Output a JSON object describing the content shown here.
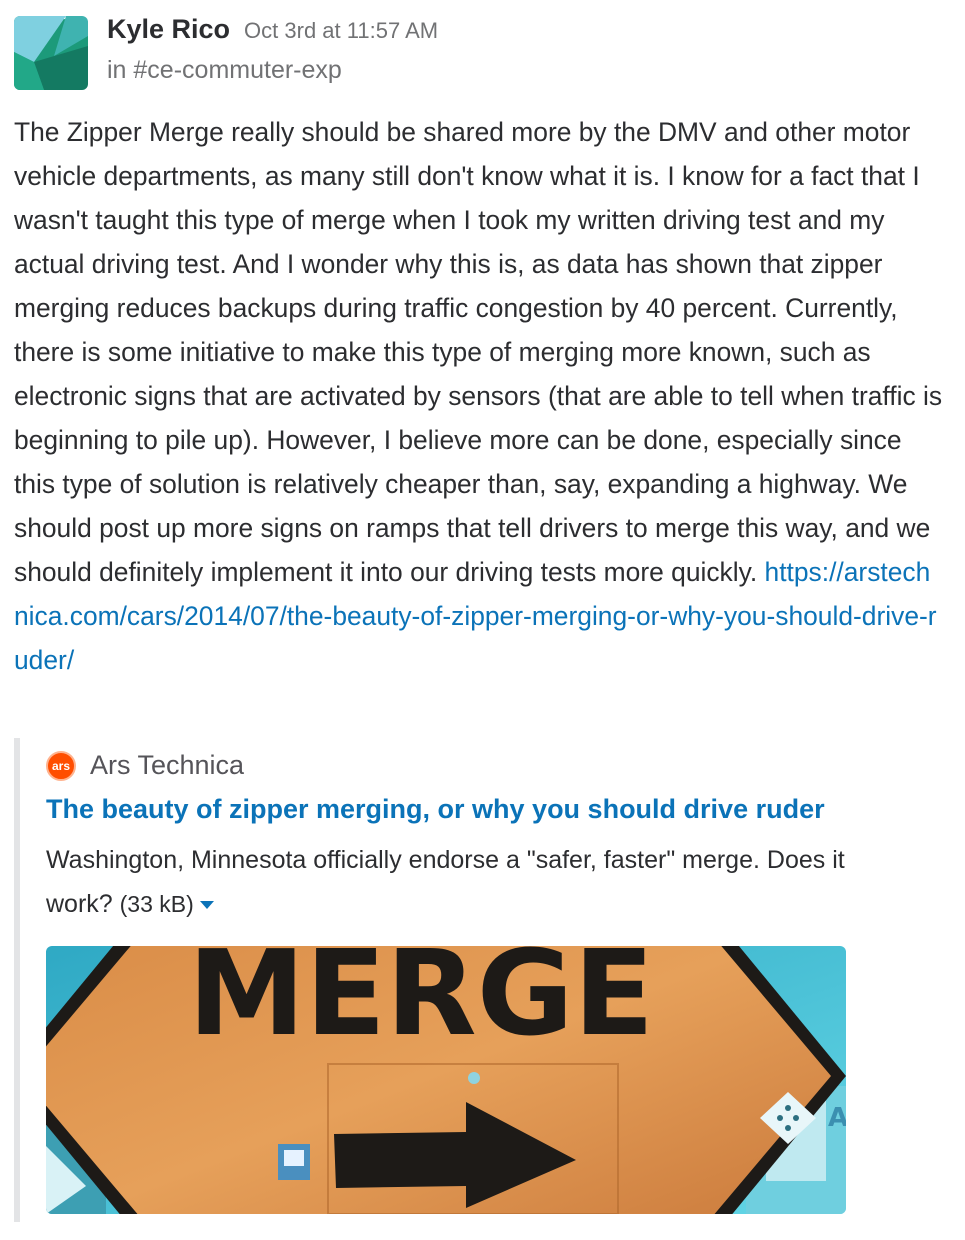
{
  "message": {
    "author": "Kyle Rico",
    "timestamp": "Oct 3rd at 11:57 AM",
    "channel_prefix": "in ",
    "channel": "#ce-commuter-exp",
    "body": "The Zipper Merge really should be shared more by the DMV and other motor vehicle departments, as many still don't know what it is. I know for a fact that I wasn't taught this type of merge when I took my written driving test and my actual driving test. And I wonder why this is, as data has shown that zipper merging reduces backups during traffic congestion by 40 percent. Currently, there is some initiative to make this type of merging more known, such as electronic signs that are activated by sensors (that are able to tell when traffic is beginning to pile up). However, I believe more can be done, especially since this type of solution is relatively cheaper than, say, expanding a highway. We should post up more signs on ramps that tell drivers to merge this way, and we should definitely implement it into our driving tests more quickly.",
    "link": "https://arstechnica.com/cars/2014/07/the-beauty-of-zipper-merging-or-why-you-should-drive-ruder/"
  },
  "attachment": {
    "service_icon_text": "ars",
    "service_name": "Ars Technica",
    "title": "The beauty of zipper merging, or why you should drive ruder",
    "description": "Washington, Minnesota officially endorse a \"safer, faster\" merge. Does it work?",
    "size": "(33 kB)",
    "image_sign_text": "MERGE",
    "image_side_text": "A"
  },
  "colors": {
    "link": "#0b73b8",
    "avatar_dark": "#1a8a6e",
    "avatar_light": "#6ec6d8",
    "sign_orange": "#e0914a",
    "sky": "#3fc1d6"
  },
  "icons": {
    "avatar": "user-avatar",
    "service": "ars-technica-icon",
    "dropdown": "caret-down-icon"
  }
}
